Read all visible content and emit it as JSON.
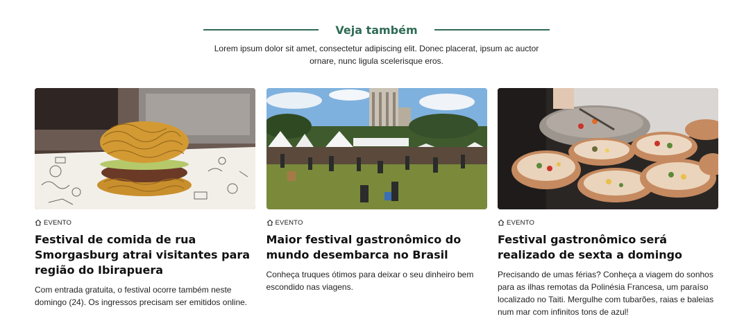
{
  "section": {
    "title": "Veja também",
    "subtitle": "Lorem ipsum dolor sit amet, consectetur adipiscing elit. Donec placerat, ipsum ac auctor ornare, nunc ligula scelerisque eros.",
    "accent_color": "#2f6b55"
  },
  "cards": [
    {
      "image": "noodle-burger-photo",
      "tag_icon": "home-icon",
      "tag": "EVENTO",
      "title": "Festival de comida de rua Smorgasburg atrai visitantes para região do Ibirapuera",
      "description": "Com entrada gratuita, o festival ocorre também neste domingo (24). Os ingressos precisam ser emitidos online."
    },
    {
      "image": "outdoor-festival-photo",
      "tag_icon": "home-icon",
      "tag": "EVENTO",
      "title": "Maior festival gastronômico do mundo desembarca no Brasil",
      "description": "Conheça truques ótimos para deixar o seu dinheiro bem escondido nas viagens."
    },
    {
      "image": "food-bowls-photo",
      "tag_icon": "home-icon",
      "tag": "EVENTO",
      "title": "Festival gastronômico será realizado de sexta a domingo",
      "description": "Precisando de umas férias? Conheça a viagem do sonhos para as ilhas remotas da Polinésia Francesa, um paraíso localizado no Taiti. Mergulhe com tubarões, raias e baleias num mar com infinitos tons de azul!"
    }
  ]
}
